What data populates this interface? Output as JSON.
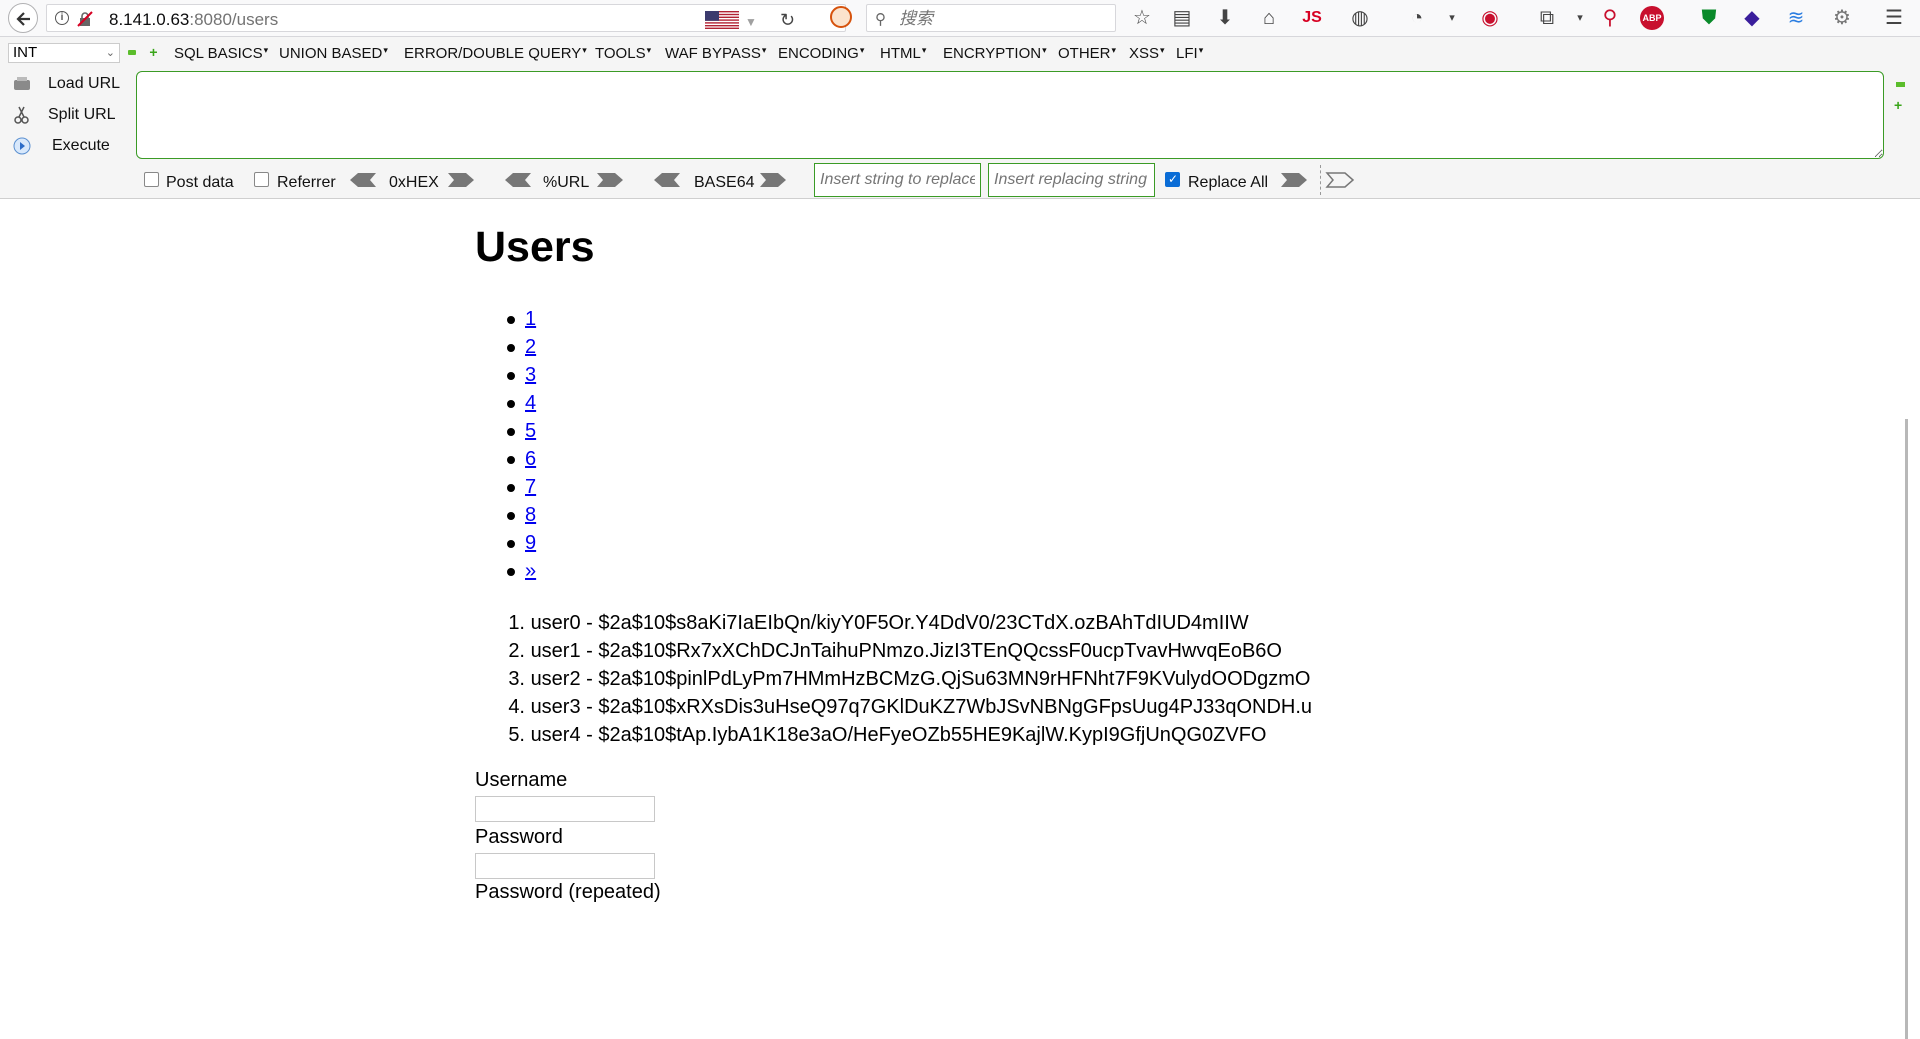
{
  "browser": {
    "url_host": "8.141.0.63",
    "url_rest": ":8080/users",
    "search_placeholder": "搜索",
    "toolbar_js_label": "JS",
    "toolbar_abp_label": "ABP"
  },
  "hackbar": {
    "select_value": "INT",
    "menus": [
      "SQL BASICS",
      "UNION BASED",
      "ERROR/DOUBLE QUERY",
      "TOOLS",
      "WAF BYPASS",
      "ENCODING",
      "HTML",
      "ENCRYPTION",
      "OTHER",
      "XSS",
      "LFI"
    ],
    "load_url": "Load URL",
    "split_url": "Split URL",
    "execute": "Execute",
    "post_data": "Post data",
    "referrer": "Referrer",
    "hex": "0xHEX",
    "url_enc": "%URL",
    "base64": "BASE64",
    "replace_placeholder": "Insert string to replace",
    "replacing_placeholder": "Insert replacing string",
    "replace_all": "Replace All",
    "replace_all_checked": true,
    "post_data_checked": false,
    "referrer_checked": false
  },
  "page": {
    "title": "Users",
    "pages": [
      "1",
      "2",
      "3",
      "4",
      "5",
      "6",
      "7",
      "8",
      "9",
      "»"
    ],
    "users": [
      {
        "num": "1.",
        "text": "user0 - $2a$10$s8aKi7IaEIbQn/kiyY0F5Or.Y4DdV0/23CTdX.ozBAhTdIUD4mIIW"
      },
      {
        "num": "2.",
        "text": "user1 - $2a$10$Rx7xXChDCJnTaihuPNmzo.JizI3TEnQQcssF0ucpTvavHwvqEoB6O"
      },
      {
        "num": "3.",
        "text": "user2 - $2a$10$pinlPdLyPm7HMmHzBCMzG.QjSu63MN9rHFNht7F9KVulydOODgzmO"
      },
      {
        "num": "4.",
        "text": "user3 - $2a$10$xRXsDis3uHseQ97q7GKlDuKZ7WbJSvNBNgGFpsUug4PJ33qONDH.u"
      },
      {
        "num": "5.",
        "text": "user4 - $2a$10$tAp.IybA1K18e3aO/HeFyeOZb55HE9KajlW.KypI9GfjUnQG0ZVFO"
      }
    ],
    "username_label": "Username",
    "password_label": "Password",
    "password_repeated_label": "Password (repeated)"
  }
}
